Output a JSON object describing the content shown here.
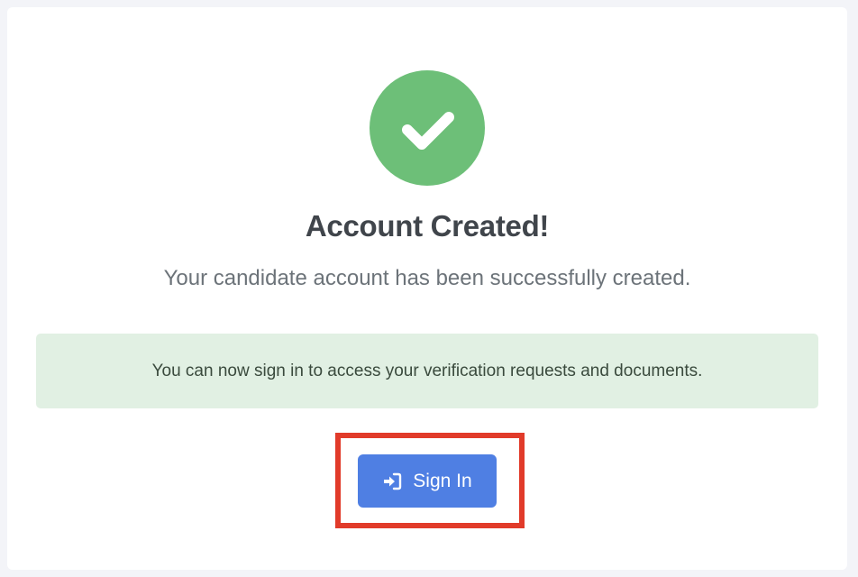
{
  "success": {
    "icon": "check-icon",
    "circle_color": "#6dbf78",
    "title": "Account Created!",
    "message": "Your candidate account has been successfully created."
  },
  "alert": {
    "text": "You can now sign in to access your verification requests and documents.",
    "background": "#e1f0e3"
  },
  "signin": {
    "label": "Sign In",
    "icon": "sign-in-icon",
    "color": "#4f7fe3",
    "highlight_color": "#e13b2a"
  }
}
